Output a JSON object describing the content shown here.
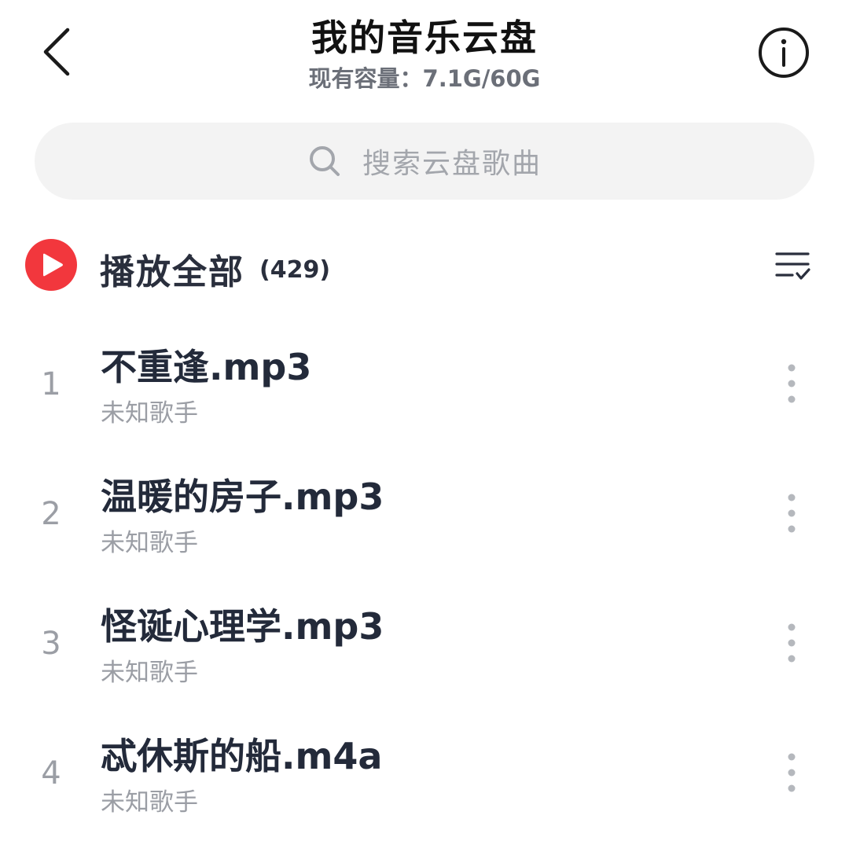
{
  "header": {
    "title": "我的音乐云盘",
    "capacity": "现有容量：7.1G/60G",
    "back_icon": "chevron-left-icon",
    "info_icon": "info-circle-icon"
  },
  "search": {
    "placeholder": "搜索云盘歌曲",
    "icon": "search-icon"
  },
  "play_all": {
    "label": "播放全部",
    "count": "(429)",
    "icon": "play-circle-icon",
    "accent_color": "#f2373d",
    "multiselect_icon": "list-check-icon"
  },
  "songs": [
    {
      "index": "1",
      "title": "不重逢.mp3",
      "artist": "未知歌手"
    },
    {
      "index": "2",
      "title": "温暖的房子.mp3",
      "artist": "未知歌手"
    },
    {
      "index": "3",
      "title": "怪诞心理学.mp3",
      "artist": "未知歌手"
    },
    {
      "index": "4",
      "title": "忒休斯的船.m4a",
      "artist": "未知歌手"
    }
  ],
  "colors": {
    "title_text": "#111111",
    "secondary_text": "#9b9ea5",
    "search_bg": "#f3f3f3"
  }
}
